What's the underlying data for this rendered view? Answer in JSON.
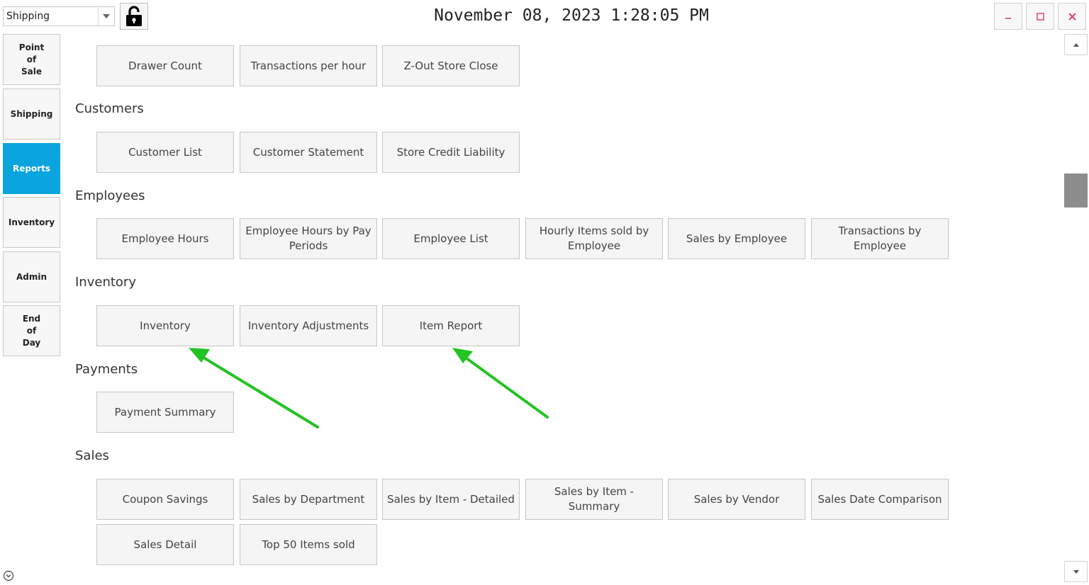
{
  "header": {
    "department_select": {
      "value": "Shipping"
    },
    "clock": "November 08, 2023 1:28:05 PM"
  },
  "nav": {
    "items": [
      {
        "label": "Point\nof\nSale"
      },
      {
        "label": "Shipping"
      },
      {
        "label": "Reports"
      },
      {
        "label": "Inventory"
      },
      {
        "label": "Admin"
      },
      {
        "label": "End\nof\nDay"
      }
    ],
    "active": "Reports"
  },
  "sections": {
    "top": {
      "buttons": [
        "Drawer Count",
        "Transactions per hour",
        "Z-Out Store Close"
      ]
    },
    "customers": {
      "title": "Customers",
      "buttons": [
        "Customer List",
        "Customer Statement",
        "Store Credit Liability"
      ]
    },
    "employees": {
      "title": "Employees",
      "buttons": [
        "Employee Hours",
        "Employee Hours by Pay Periods",
        "Employee List",
        "Hourly Items sold by Employee",
        "Sales by Employee",
        "Transactions by Employee"
      ]
    },
    "inventory": {
      "title": "Inventory",
      "buttons": [
        "Inventory",
        "Inventory Adjustments",
        "Item Report"
      ]
    },
    "payments": {
      "title": "Payments",
      "buttons": [
        "Payment Summary"
      ]
    },
    "sales": {
      "title": "Sales",
      "buttons": [
        "Coupon Savings",
        "Sales by Department",
        "Sales by Item - Detailed",
        "Sales by Item - Summary",
        "Sales by Vendor",
        "Sales Date Comparison",
        "Sales Detail",
        "Top 50 Items sold"
      ]
    }
  },
  "colors": {
    "accent": "#0aa4de",
    "annotation_arrow": "#22c322",
    "window_control": "#e0436a"
  }
}
